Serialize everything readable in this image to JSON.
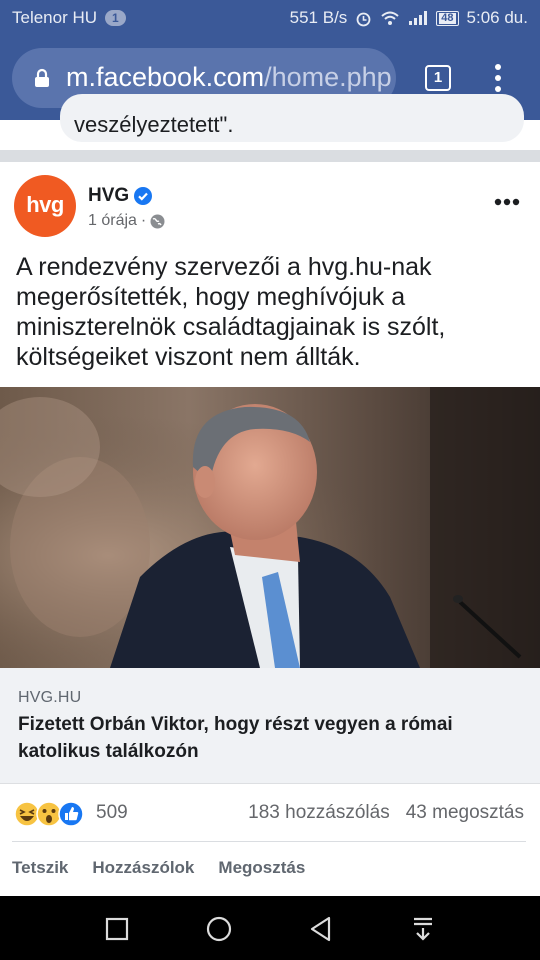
{
  "status_bar": {
    "carrier": "Telenor HU",
    "notification_count": "1",
    "network_speed": "551 B/s",
    "battery_level": "48",
    "time": "5:06 du."
  },
  "browser": {
    "url_domain": "m.facebook.com",
    "url_path": "/home.php",
    "tab_count": "1",
    "icons": [
      "lock-icon",
      "tabs-icon",
      "menu-icon"
    ]
  },
  "previous_comment": {
    "text": "veszélyeztetett\"."
  },
  "post": {
    "page_name": "HVG",
    "avatar_text": "hvg",
    "time_ago": "1 órája",
    "meta_separator": "·",
    "body": "A rendezvény szervezői a hvg.hu-nak megerősítették, hogy meghívójuk a miniszterelnök családtagjainak is szólt, költségeiket viszont nem állták.",
    "link": {
      "domain": "HVG.HU",
      "title": "Fizetett Orbán Viktor, hogy részt vegyen a római katolikus találkozón"
    },
    "reactions": {
      "count": "509",
      "types": [
        "haha",
        "wow",
        "like"
      ]
    },
    "comments_count": "183 hozzászólás",
    "shares_count": "43 megosztás",
    "actions": {
      "like": "Tetszik",
      "comment": "Hozzászólok",
      "share": "Megosztás"
    }
  },
  "colors": {
    "facebook_blue": "#3b5998",
    "hvg_orange": "#f05a22",
    "verified_blue": "#1877f2"
  }
}
